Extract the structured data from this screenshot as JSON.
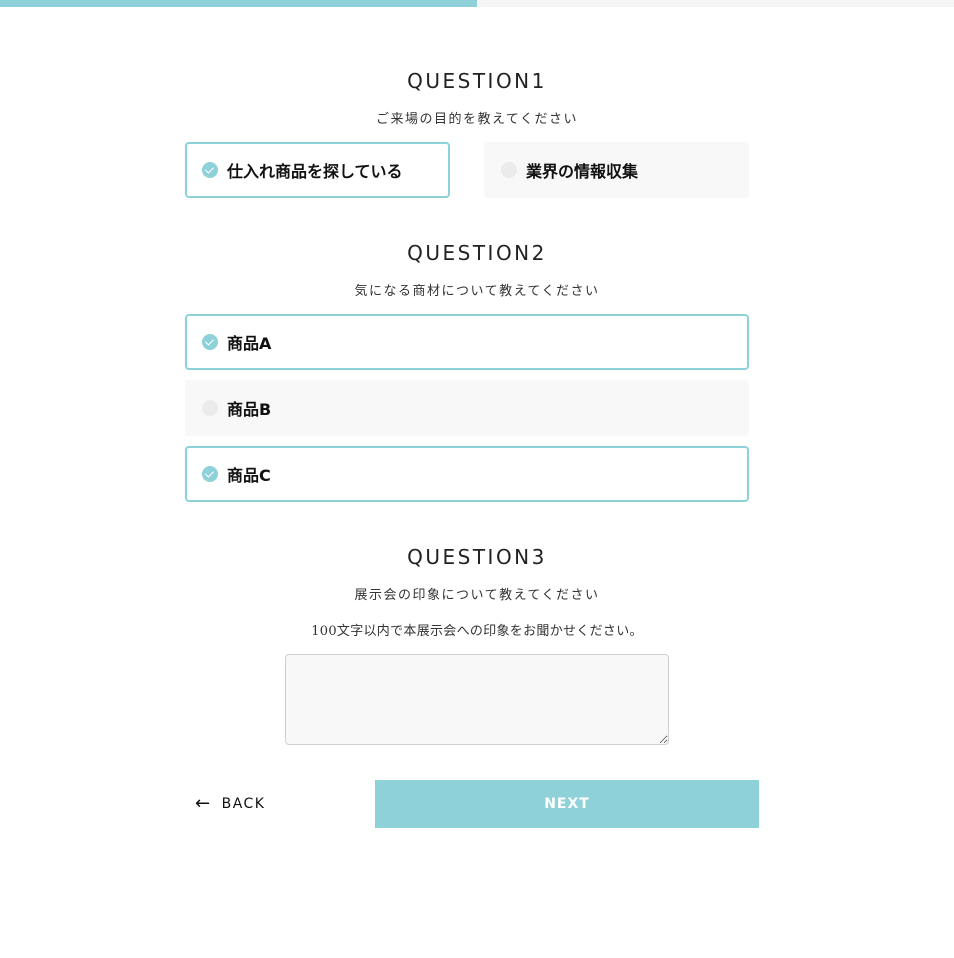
{
  "progress": {
    "fraction": 0.5
  },
  "colors": {
    "accent": "#8fd1d9",
    "option_bg": "#f8f8f8",
    "radio_off": "#ebebeb"
  },
  "q1": {
    "title": "QUESTION1",
    "subtitle": "ご来場の目的を教えてください",
    "options": [
      {
        "label": "仕入れ商品を探している",
        "checked": true
      },
      {
        "label": "業界の情報収集",
        "checked": false
      }
    ]
  },
  "q2": {
    "title": "QUESTION2",
    "subtitle": "気になる商材について教えてください",
    "options": [
      {
        "label": "商品A",
        "checked": true
      },
      {
        "label": "商品B",
        "checked": false
      },
      {
        "label": "商品C",
        "checked": true
      }
    ]
  },
  "q3": {
    "title": "QUESTION3",
    "subtitle": "展示会の印象について教えてください",
    "note": "100文字以内で本展示会への印象をお聞かせください。",
    "value": ""
  },
  "nav": {
    "back_label": "BACK",
    "back_icon": "arrow-left-icon",
    "next_label": "NEXT"
  }
}
